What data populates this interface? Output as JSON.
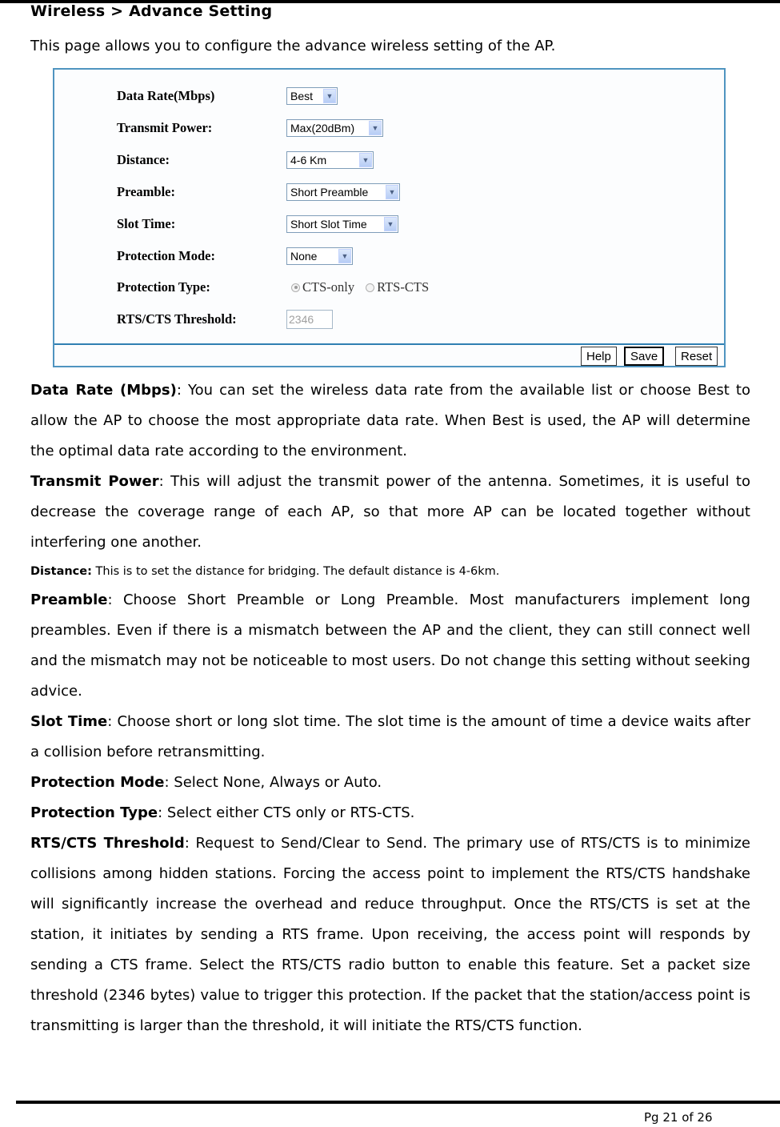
{
  "heading": "Wireless > Advance Setting",
  "intro": "This page allows you to configure the advance wireless setting of the AP.",
  "form": {
    "fields": [
      {
        "label": "Data Rate(Mbps)",
        "type": "select",
        "value": "Best"
      },
      {
        "label": "Transmit Power:",
        "type": "select",
        "value": "Max(20dBm)"
      },
      {
        "label": "Distance:",
        "type": "select",
        "value": "4-6 Km"
      },
      {
        "label": "Preamble:",
        "type": "select",
        "value": "Short Preamble"
      },
      {
        "label": "Slot Time:",
        "type": "select",
        "value": "Short Slot Time"
      },
      {
        "label": "Protection Mode:",
        "type": "select",
        "value": "None"
      },
      {
        "label": "Protection Type:",
        "type": "radio",
        "options": [
          "CTS-only",
          "RTS-CTS"
        ],
        "selected": "CTS-only"
      },
      {
        "label": "RTS/CTS Threshold:",
        "type": "text",
        "value": "2346"
      }
    ],
    "buttons": {
      "help": "Help",
      "save": "Save",
      "reset": "Reset"
    }
  },
  "descriptions": [
    {
      "term": "Data Rate (Mbps)",
      "text": ": You can set the wireless data rate from the available list or choose Best to allow the AP to choose the most appropriate data rate.  When Best is used, the AP will determine the optimal data rate according to the environment."
    },
    {
      "term": "Transmit Power",
      "text": ": This will adjust the transmit power of the antenna. Sometimes, it is useful to decrease the coverage range of each AP, so that more AP can be located together without interfering one another."
    },
    {
      "term": "Distance:",
      "text": " This is to set the distance for bridging. The default distance is 4-6km."
    },
    {
      "term": "Preamble",
      "text": ": Choose Short Preamble or Long Preamble. Most manufacturers implement long preambles. Even if there is a mismatch between the AP and the client, they can still connect well and the mismatch may not be noticeable to most users. Do not change this setting without seeking advice."
    },
    {
      "term": "Slot Time",
      "text": ": Choose short or long slot time.  The slot time is the amount of time a device waits after a collision before retransmitting."
    },
    {
      "term": "Protection Mode",
      "text": ": Select None, Always or Auto."
    },
    {
      "term": "Protection Type",
      "text": ": Select either CTS only or RTS-CTS."
    },
    {
      "term": "RTS/CTS Threshold",
      "text": ": Request to Send/Clear to Send. The primary use of RTS/CTS is to minimize collisions among hidden stations. Forcing the access point to implement the RTS/CTS handshake will significantly increase the overhead and reduce throughput. Once the RTS/CTS is set at the station, it initiates by sending a RTS frame. Upon receiving, the access point will responds by sending a CTS frame. Select the RTS/CTS radio button to enable this feature. Set a packet size threshold (2346 bytes) value to trigger this protection. If the packet that the station/access point is transmitting is larger than the threshold, it will initiate the RTS/CTS function."
    }
  ],
  "footer": {
    "page": "Pg 21 of 26"
  }
}
